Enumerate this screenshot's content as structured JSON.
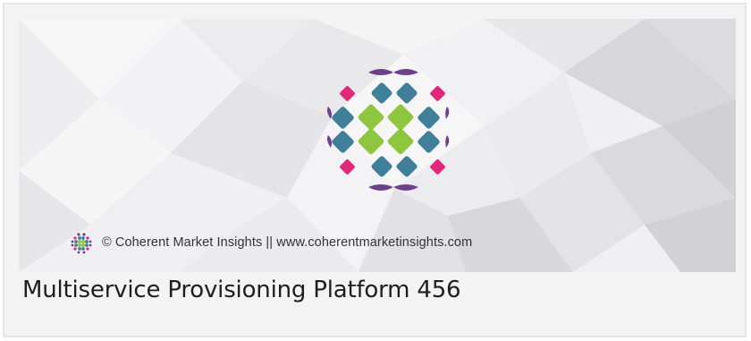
{
  "hero": {
    "credit": "© Coherent Market Insights || www.coherentmarketinsights.com",
    "logo_icon": "coherent-market-insights-logo"
  },
  "title": "Multiservice Provisioning Platform 456",
  "colors": {
    "purple": "#6f3f8c",
    "pink": "#e0287a",
    "blue": "#3f7f9a",
    "green": "#8ec63f",
    "title_text": "#1e1e1e",
    "credit_text": "#333333",
    "card_bg": "#f3f3f3"
  }
}
